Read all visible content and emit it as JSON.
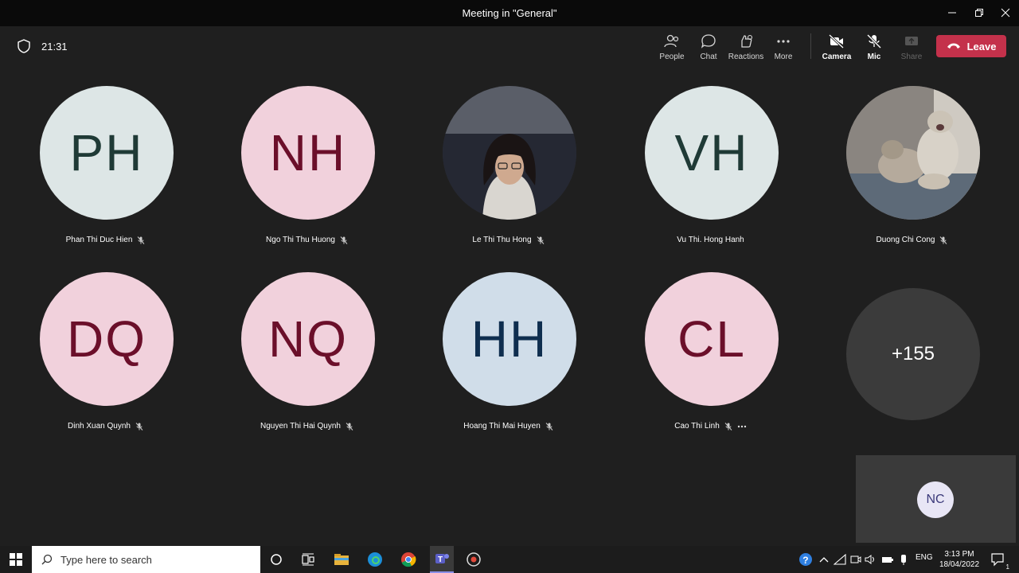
{
  "window": {
    "title": "Meeting in \"General\""
  },
  "meeting": {
    "elapsed": "21:31"
  },
  "toolbar": {
    "people": "People",
    "chat": "Chat",
    "reactions": "Reactions",
    "more": "More",
    "camera": "Camera",
    "mic": "Mic",
    "share": "Share",
    "leave": "Leave"
  },
  "participants": [
    {
      "initials": "PH",
      "name": "Phan Thi Duc Hien",
      "muted": true
    },
    {
      "initials": "NH",
      "name": "Ngo Thi Thu Huong",
      "muted": true
    },
    {
      "initials": "",
      "name": "Le Thi Thu Hong",
      "muted": true
    },
    {
      "initials": "VH",
      "name": "Vu Thi. Hong Hanh",
      "muted": false
    },
    {
      "initials": "",
      "name": "Duong Chi Cong",
      "muted": true
    },
    {
      "initials": "DQ",
      "name": "Dinh Xuan Quynh",
      "muted": true
    },
    {
      "initials": "NQ",
      "name": "Nguyen Thi Hai Quynh",
      "muted": true
    },
    {
      "initials": "HH",
      "name": "Hoang Thi Mai Huyen",
      "muted": true
    },
    {
      "initials": "CL",
      "name": "Cao Thi Linh",
      "muted": true
    }
  ],
  "overflow": {
    "label": "+155"
  },
  "self": {
    "initials": "NC"
  },
  "taskbar": {
    "search_placeholder": "Type here to search",
    "lang": "ENG",
    "time": "3:13 PM",
    "date": "18/04/2022",
    "notification_count": "1"
  },
  "colors": {
    "leave": "#c4314b",
    "avatar_teal_bg": "#dde6e6",
    "avatar_teal_fg": "#1f3a36",
    "avatar_pink_bg": "#f1d1dc",
    "avatar_pink_fg": "#6b0f2a",
    "avatar_blue_bg": "#d0dde9",
    "avatar_blue_fg": "#0f2e4f"
  }
}
